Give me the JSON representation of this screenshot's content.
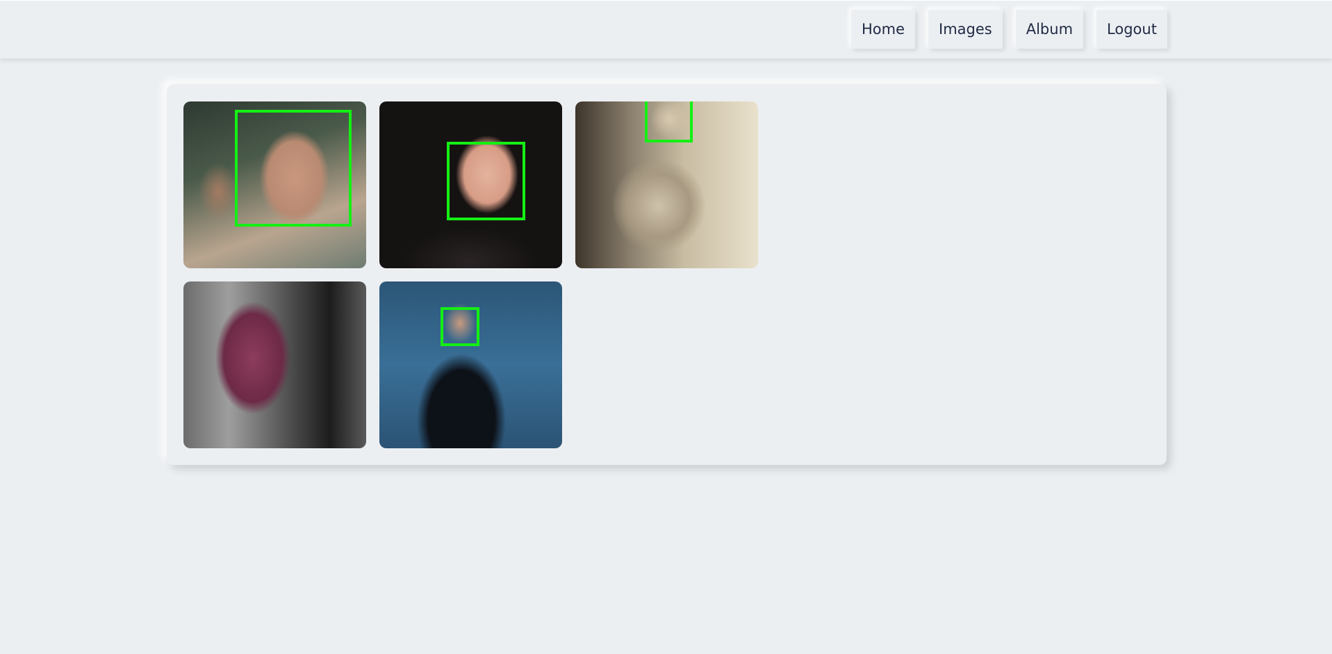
{
  "nav": {
    "items": [
      {
        "label": "Home"
      },
      {
        "label": "Images"
      },
      {
        "label": "Album"
      },
      {
        "label": "Logout"
      }
    ]
  },
  "gallery": {
    "images": [
      {
        "photo": "face-photo-1",
        "face_detected": true
      },
      {
        "photo": "face-photo-2",
        "face_detected": true
      },
      {
        "photo": "face-photo-3",
        "face_detected": true
      },
      {
        "photo": "face-photo-4",
        "face_detected": false
      },
      {
        "photo": "face-photo-5",
        "face_detected": true
      }
    ]
  },
  "colors": {
    "background": "#eceff2",
    "nav_text": "#1f2a44",
    "face_box": "#14f014"
  }
}
